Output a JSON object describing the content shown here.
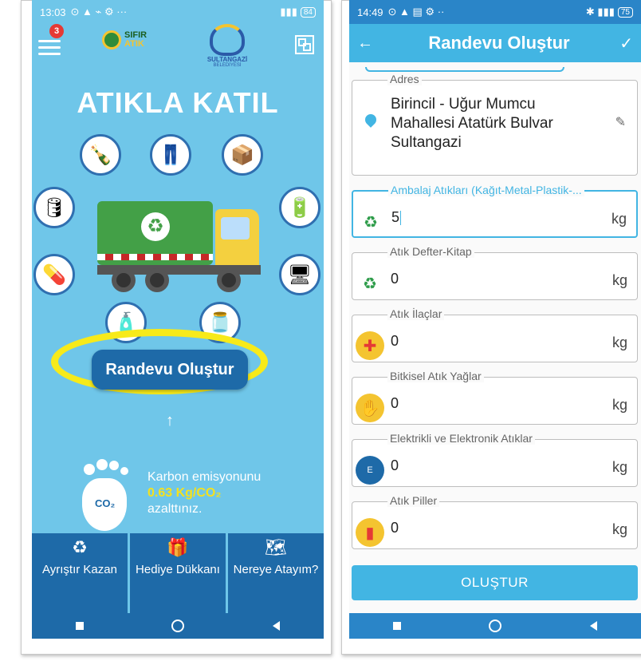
{
  "left": {
    "status": {
      "time": "13:03",
      "icons": "⊙ ▲ ⌁ ⚙ ···",
      "battery": "84"
    },
    "badge_count": "3",
    "logo_sifir": {
      "line1": "SIFIR",
      "line2": "ATIK"
    },
    "logo_belediye": {
      "line1": "SULTANGAZİ",
      "line2": "BELEDİYESİ"
    },
    "headline": "ATIKLA KATIL",
    "cta_label": "Randevu Oluştur",
    "carbon": {
      "line1": "Karbon emisyonunu",
      "value": "0.63 Kg/CO₂",
      "line3": "azalttınız."
    },
    "foot_label": "CO₂",
    "tabs": [
      {
        "label": "Ayrıştır Kazan",
        "icon": "recycle-icon"
      },
      {
        "label": "Hediye Dükkanı",
        "icon": "gift-icon"
      },
      {
        "label": "Nereye Atayım?",
        "icon": "map-icon"
      }
    ]
  },
  "right": {
    "status": {
      "time": "14:49",
      "icons": "⊙ ▲ ▤ ⚙ ··",
      "battery": "75"
    },
    "appbar_title": "Randevu Oluştur",
    "address": {
      "legend": "Adres",
      "value": "Birincil - Uğur Mumcu Mahallesi Atatürk Bulvar Sultangazi"
    },
    "fields": [
      {
        "legend": "Ambalaj Atıkları (Kağıt-Metal-Plastik-...",
        "value": "5",
        "unit": "kg",
        "icon": "recycle-icon",
        "color": "#2e9c4a"
      },
      {
        "legend": "Atık Defter-Kitap",
        "value": "0",
        "unit": "kg",
        "icon": "recycle-icon",
        "color": "#2e9c4a"
      },
      {
        "legend": "Atık İlaçlar",
        "value": "0",
        "unit": "kg",
        "icon": "medicine-bag-icon",
        "color": "#e53935"
      },
      {
        "legend": "Bitkisel Atık Yağlar",
        "value": "0",
        "unit": "kg",
        "icon": "oil-hand-icon",
        "color": "#f4c430"
      },
      {
        "legend": "Elektrikli ve Elektronik Atıklar",
        "value": "0",
        "unit": "kg",
        "icon": "e-waste-icon",
        "color": "#1e6aa8"
      },
      {
        "legend": "Atık Piller",
        "value": "0",
        "unit": "kg",
        "icon": "battery-icon",
        "color": "#e53935"
      }
    ],
    "submit_label": "OLUŞTUR"
  },
  "colors": {
    "sky": "#6fc6e9",
    "navy": "#1e6aa8",
    "accent": "#42b5e3",
    "highlight": "#f7ea1a"
  }
}
